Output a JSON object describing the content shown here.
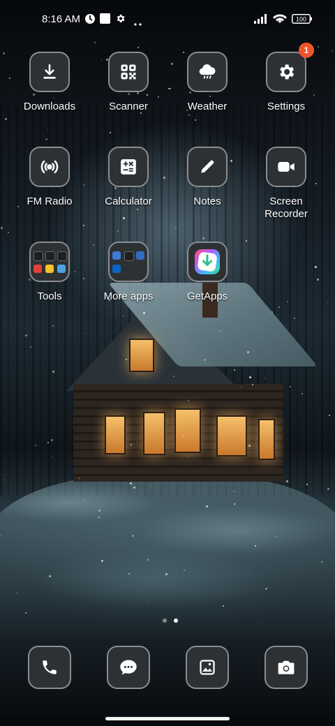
{
  "status_bar": {
    "time": "8:16 AM",
    "battery": "100",
    "icons": [
      "clock-app-icon",
      "square-notification-icon",
      "gear-icon",
      "more-dots-icon",
      "signal-icon",
      "wifi-icon",
      "battery-icon"
    ]
  },
  "apps": [
    {
      "id": "downloads",
      "label": "Downloads",
      "icon": "download-icon"
    },
    {
      "id": "scanner",
      "label": "Scanner",
      "icon": "qr-scan-icon"
    },
    {
      "id": "weather",
      "label": "Weather",
      "icon": "cloud-rain-icon"
    },
    {
      "id": "settings",
      "label": "Settings",
      "icon": "gear-icon",
      "badge": "1"
    },
    {
      "id": "fm-radio",
      "label": "FM Radio",
      "icon": "radio-waves-icon"
    },
    {
      "id": "calculator",
      "label": "Calculator",
      "icon": "calculator-icon"
    },
    {
      "id": "notes",
      "label": "Notes",
      "icon": "pencil-icon"
    },
    {
      "id": "screen-recorder",
      "label": "Screen\nRecorder",
      "icon": "video-camera-icon"
    },
    {
      "id": "tools",
      "label": "Tools",
      "icon": "folder-icon"
    },
    {
      "id": "more-apps",
      "label": "More apps",
      "icon": "folder-icon"
    },
    {
      "id": "getapps",
      "label": "GetApps",
      "icon": "getapps-icon"
    }
  ],
  "dock": [
    {
      "id": "phone",
      "icon": "phone-icon"
    },
    {
      "id": "messages",
      "icon": "chat-bubble-icon"
    },
    {
      "id": "gallery",
      "icon": "gallery-icon"
    },
    {
      "id": "camera",
      "icon": "camera-icon"
    }
  ],
  "page_indicator": {
    "pages": 2,
    "current": 2
  },
  "colors": {
    "badge": "#f0552a",
    "tile_bg": "#2e3134",
    "tile_border": "#8b8e91"
  }
}
